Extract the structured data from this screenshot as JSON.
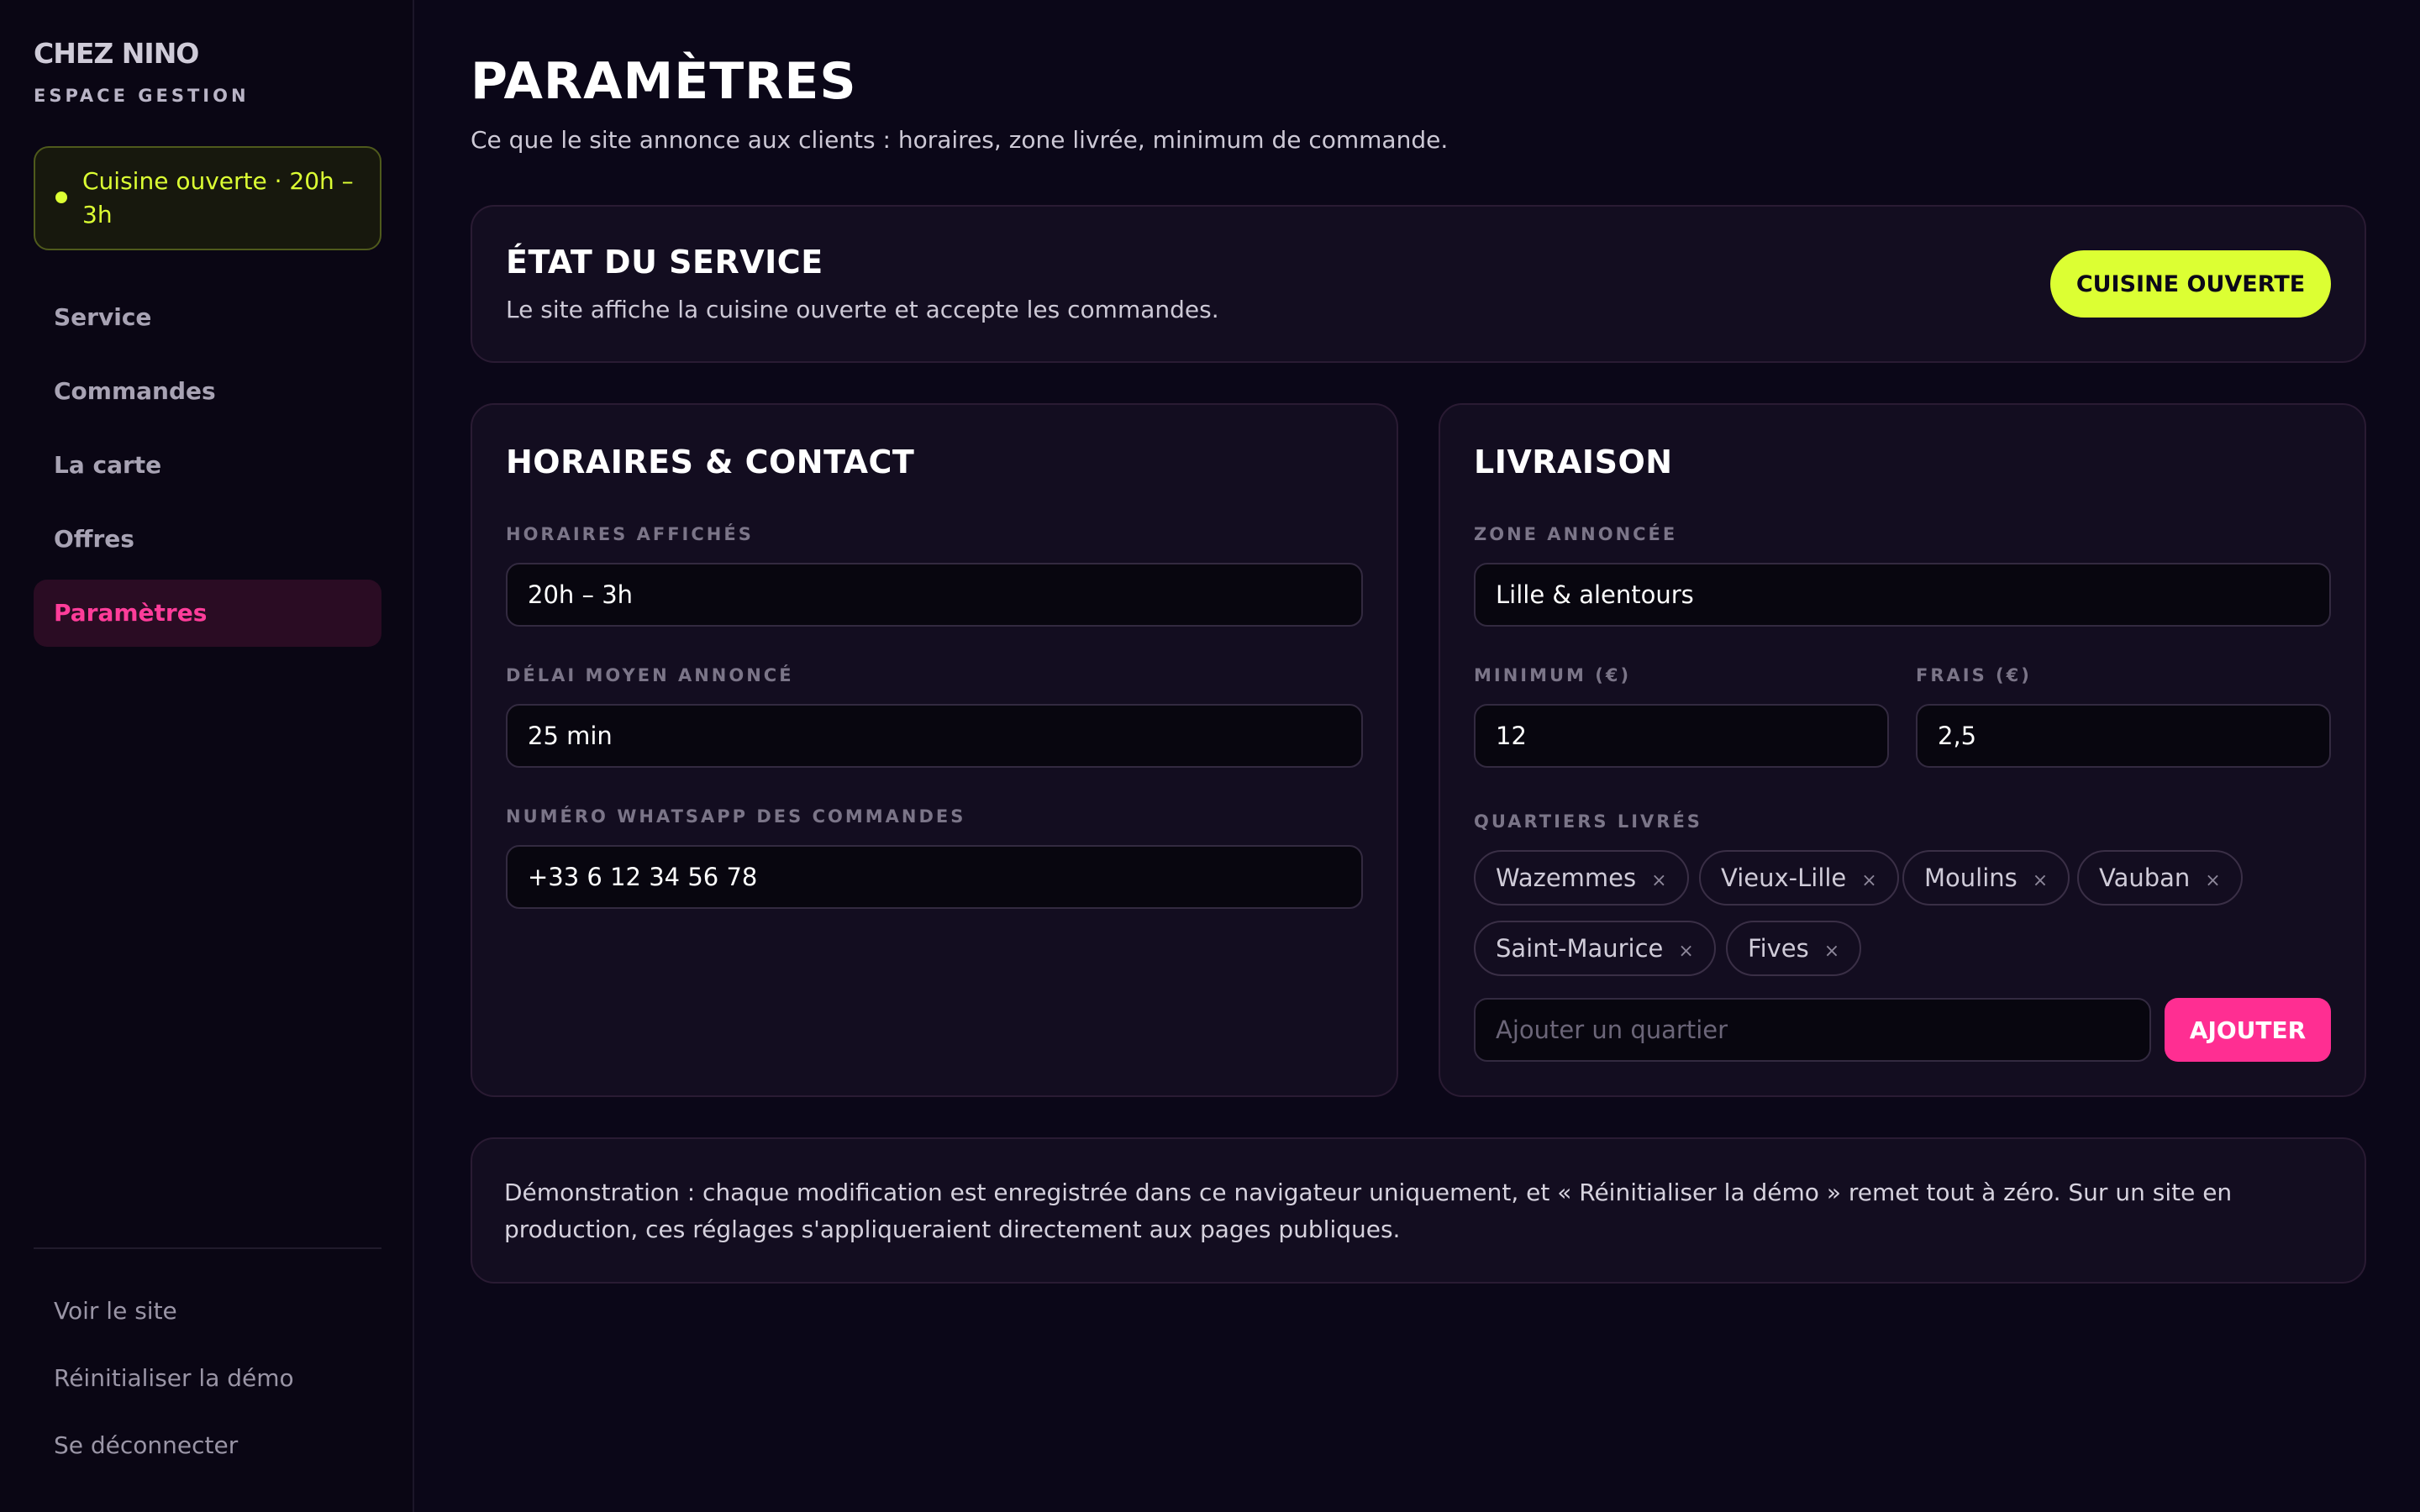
{
  "sidebar": {
    "brand": "CHEZ NINO",
    "subtitle": "ESPACE GESTION",
    "status": "Cuisine ouverte · 20h – 3h",
    "nav": [
      {
        "label": "Service"
      },
      {
        "label": "Commandes"
      },
      {
        "label": "La carte"
      },
      {
        "label": "Offres"
      },
      {
        "label": "Paramètres",
        "active": true
      }
    ],
    "footer": [
      "Voir le site",
      "Réinitialiser la démo",
      "Se déconnecter"
    ]
  },
  "page": {
    "title": "PARAMÈTRES",
    "subtitle": "Ce que le site annonce aux clients : horaires, zone livrée, minimum de commande."
  },
  "service": {
    "title": "ÉTAT DU SERVICE",
    "description": "Le site affiche la cuisine ouverte et accepte les commandes.",
    "button": "CUISINE OUVERTE"
  },
  "hours": {
    "title": "HORAIRES & CONTACT",
    "hours_label": "HORAIRES AFFICHÉS",
    "hours_value": "20h – 3h",
    "delay_label": "DÉLAI MOYEN ANNONCÉ",
    "delay_value": "25 min",
    "whatsapp_label": "NUMÉRO WHATSAPP DES COMMANDES",
    "whatsapp_value": "+33 6 12 34 56 78"
  },
  "delivery": {
    "title": "LIVRAISON",
    "zone_label": "ZONE ANNONCÉE",
    "zone_value": "Lille & alentours",
    "min_label": "MINIMUM (€)",
    "min_value": "12",
    "fee_label": "FRAIS (€)",
    "fee_value": "2,5",
    "districts_label": "QUARTIERS LIVRÉS",
    "districts": [
      "Wazemmes",
      "Vieux-Lille",
      "Moulins",
      "Vauban",
      "Saint-Maurice",
      "Fives"
    ],
    "remove_glyph": "×",
    "add_placeholder": "Ajouter un quartier",
    "add_button": "AJOUTER"
  },
  "note": "Démonstration : chaque modification est enregistrée dans ce navigateur uniquement, et « Réinitialiser la démo » remet tout à zéro. Sur un site en production, ces réglages s'appliqueraient directement aux pages publiques.",
  "colors": {
    "background": "#0b0718",
    "accent_lime": "#dcff33",
    "accent_pink": "#ff2e92",
    "card": "#130d20"
  }
}
